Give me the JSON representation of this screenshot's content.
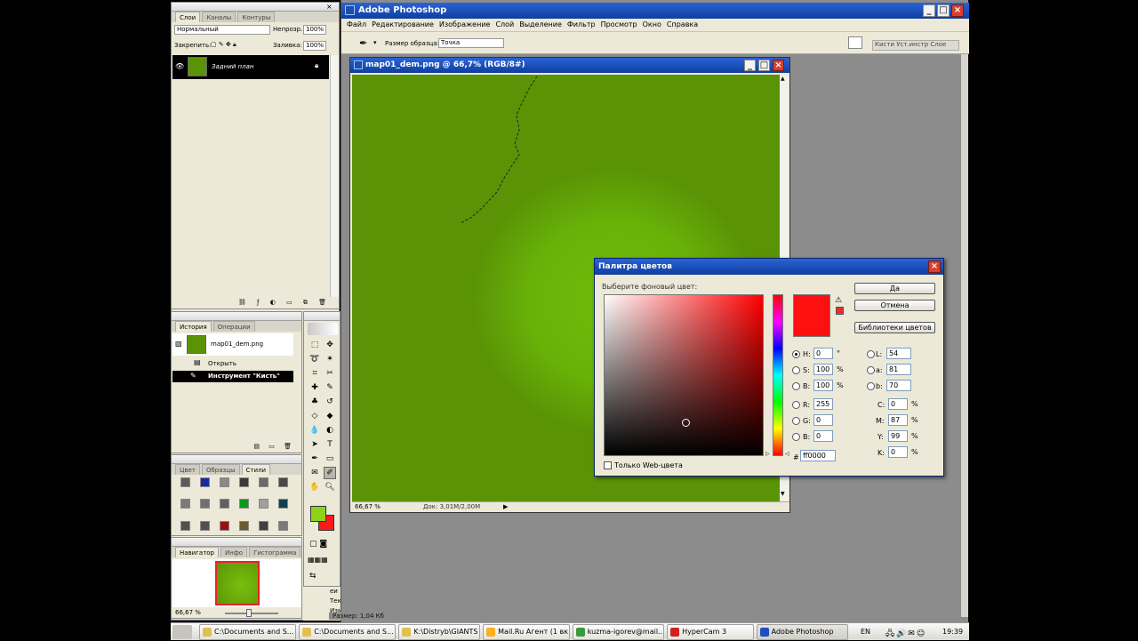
{
  "app": {
    "title": "Adobe Photoshop"
  },
  "menu": [
    "Файл",
    "Редактирование",
    "Изображение",
    "Слой",
    "Выделение",
    "Фильтр",
    "Просмотр",
    "Окно",
    "Справка"
  ],
  "options_bar": {
    "sample_label": "Размер образца:",
    "sample_value": "Точка",
    "right_tabs": "Кисти Уст.инстр  Слое"
  },
  "layers_palette": {
    "tabs": [
      "Слои",
      "Каналы",
      "Контуры"
    ],
    "blend_mode": "Нормальный",
    "opacity_label": "Непрозр.:",
    "opacity_value": "100%",
    "lock_label": "Закрепить:",
    "fill_label": "Заливка:",
    "fill_value": "100%",
    "layer_name": "Задний план"
  },
  "history_palette": {
    "tabs": [
      "История",
      "Операции"
    ],
    "snapshot_name": "map01_dem.png",
    "items": [
      "Открыть",
      "Инструмент \"Кисть\""
    ]
  },
  "swatches_palette": {
    "tabs": [
      "Цвет",
      "Образцы",
      "Стили"
    ]
  },
  "navigator_palette": {
    "tabs": [
      "Навигатор",
      "Инфо",
      "Гистограмма"
    ],
    "zoom": "66,67 %"
  },
  "document": {
    "title": "map01_dem.png @ 66,7% (RGB/8#)",
    "zoom": "66,67 %",
    "doc_info": "Док: 3,01M/2,00M"
  },
  "color_picker": {
    "title": "Палитра цветов",
    "prompt": "Выберите фоновый цвет:",
    "ok_label": "Да",
    "cancel_label": "Отмена",
    "libraries_label": "Библиотеки цветов",
    "web_only_label": "Только Web-цвета",
    "hsb": [
      {
        "label": "H:",
        "value": "0",
        "unit": "°"
      },
      {
        "label": "S:",
        "value": "100",
        "unit": "%"
      },
      {
        "label": "B:",
        "value": "100",
        "unit": "%"
      }
    ],
    "rgb": [
      {
        "label": "R:",
        "value": "255"
      },
      {
        "label": "G:",
        "value": "0"
      },
      {
        "label": "B:",
        "value": "0"
      }
    ],
    "lab": [
      {
        "label": "L:",
        "value": "54"
      },
      {
        "label": "a:",
        "value": "81"
      },
      {
        "label": "b:",
        "value": "70"
      }
    ],
    "cmyk": [
      {
        "label": "C:",
        "value": "0",
        "unit": "%"
      },
      {
        "label": "M:",
        "value": "87",
        "unit": "%"
      },
      {
        "label": "Y:",
        "value": "99",
        "unit": "%"
      },
      {
        "label": "K:",
        "value": "0",
        "unit": "%"
      }
    ],
    "hex_label": "#",
    "hex_value": "ff0000",
    "current_color": "#ff1010"
  },
  "behind_text": [
    "еи",
    "Тек",
    "Изм",
    "Размер: 1,04 Кб"
  ],
  "taskbar": {
    "items": [
      "C:\\Documents and S...",
      "C:\\Documents and S...",
      "K:\\Distryb\\GIANTS E...",
      "Mail.Ru Агент (1 вк...",
      "kuzma-igorev@mail....",
      "HyperCam 3",
      "Adobe Photoshop"
    ],
    "lang": "EN",
    "clock": "19:39"
  },
  "colors": {
    "canvas_green": "#5a9306",
    "foreground": "#8fd21a",
    "background": "#ff1a1a",
    "workspace": "#8c8c8c"
  }
}
